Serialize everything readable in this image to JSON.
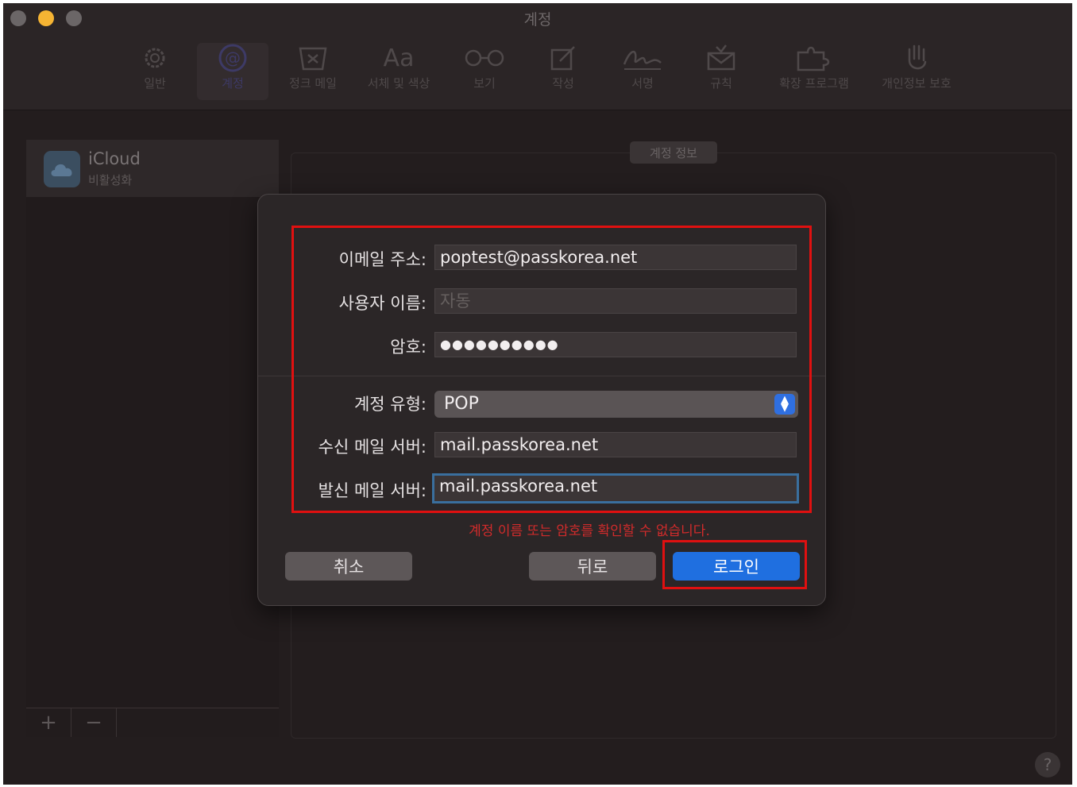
{
  "window": {
    "title": "계정"
  },
  "toolbar": {
    "items": [
      {
        "label": "일반",
        "icon": "gear-icon"
      },
      {
        "label": "계정",
        "icon": "at-icon"
      },
      {
        "label": "정크 메일",
        "icon": "junk-mail-icon"
      },
      {
        "label": "서체 및 색상",
        "icon": "font-icon"
      },
      {
        "label": "보기",
        "icon": "glasses-icon"
      },
      {
        "label": "작성",
        "icon": "compose-icon"
      },
      {
        "label": "서명",
        "icon": "signature-icon"
      },
      {
        "label": "규칙",
        "icon": "rules-icon"
      },
      {
        "label": "확장 프로그램",
        "icon": "puzzle-icon"
      },
      {
        "label": "개인정보 보호",
        "icon": "hand-icon"
      }
    ]
  },
  "sidebar": {
    "account": {
      "name": "iCloud",
      "status": "비활성화"
    },
    "add_label": "+",
    "remove_label": "−"
  },
  "detail": {
    "tab_label": "계정 정보"
  },
  "dialog": {
    "email": {
      "label": "이메일 주소:",
      "value": "poptest@passkorea.net"
    },
    "username": {
      "label": "사용자 이름:",
      "placeholder": "자동"
    },
    "password": {
      "label": "암호:",
      "value": "●●●●●●●●●●"
    },
    "account_type": {
      "label": "계정 유형:",
      "value": "POP"
    },
    "incoming": {
      "label": "수신 메일 서버:",
      "value": "mail.passkorea.net"
    },
    "outgoing": {
      "label": "발신 메일 서버:",
      "value": "mail.passkorea.net"
    },
    "error": "계정 이름 또는 암호를 확인할 수 없습니다.",
    "buttons": {
      "cancel": "취소",
      "back": "뒤로",
      "login": "로그인"
    }
  },
  "help": {
    "label": "?"
  },
  "colors": {
    "highlight": "#e01010",
    "accent": "#1f6fe0",
    "error": "#d12b2b"
  }
}
